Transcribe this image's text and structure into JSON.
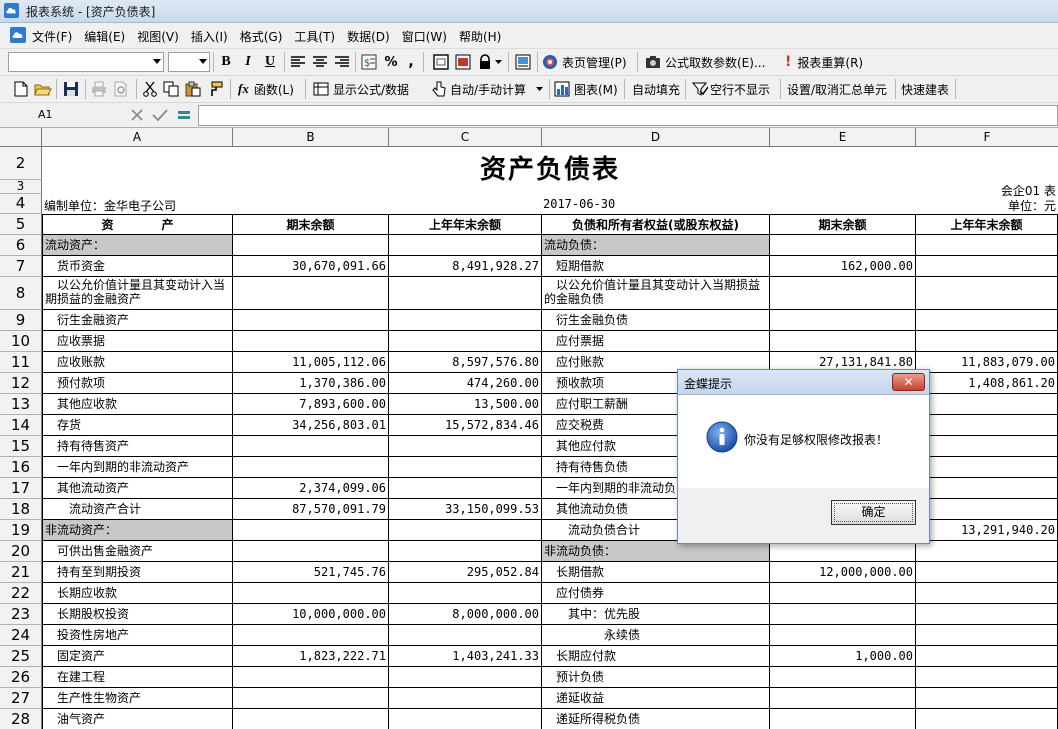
{
  "window": {
    "title": "报表系统 - [资产负债表]"
  },
  "menu": [
    "文件(F)",
    "编辑(E)",
    "视图(V)",
    "插入(I)",
    "格式(G)",
    "工具(T)",
    "数据(D)",
    "窗口(W)",
    "帮助(H)"
  ],
  "toolbar1": {
    "bold": "B",
    "italic": "I",
    "underline": "U",
    "percent": "%",
    "comma": ",",
    "page_manage": "表页管理(P)",
    "formula_params": "公式取数参数(E)...",
    "recalc": "报表重算(R)"
  },
  "toolbar2": {
    "function": "函数(L)",
    "show_formula": "显示公式/数据",
    "auto_manual": "自动/手动计算",
    "chart": "图表(M)",
    "auto_fill": "自动填充",
    "hide_blank": "空行不显示",
    "toggle_summary": "设置/取消汇总单元",
    "quick_build": "快速建表"
  },
  "formula_bar": {
    "cell_ref": "A1",
    "value": ""
  },
  "sheet": {
    "columns": [
      "A",
      "B",
      "C",
      "D",
      "E",
      "F"
    ],
    "row_numbers": [
      "2",
      "3",
      "4",
      "5",
      "6",
      "7",
      "8",
      "9",
      "10",
      "11",
      "12",
      "13",
      "14",
      "15",
      "16",
      "17",
      "18",
      "19",
      "20",
      "21",
      "22",
      "23",
      "24",
      "25",
      "26",
      "27",
      "28"
    ],
    "title": "资产负债表",
    "form_no": "会企01 表",
    "unit_label": "编制单位：金华电子公司",
    "date": "2017-06-30",
    "currency_unit": "单位：元",
    "headers": [
      "资　　　　产",
      "期末余额",
      "上年年末余额",
      "负债和所有者权益(或股东权益)",
      "期末余额",
      "上年年末余额"
    ],
    "rows": [
      {
        "a": "流动资产：",
        "b": "",
        "c": "",
        "d": "流动负债：",
        "e": "",
        "f": "",
        "ga": true,
        "gd": true
      },
      {
        "a": "　货币资金",
        "b": "30,670,091.66",
        "c": "8,491,928.27",
        "d": "　短期借款",
        "e": "162,000.00",
        "f": ""
      },
      {
        "a": "　以公允价值计量且其变动计入当期损益的金融资产",
        "b": "",
        "c": "",
        "d": "　以公允价值计量且其变动计入当期损益的金融负债",
        "e": "",
        "f": "",
        "two": true
      },
      {
        "a": "　衍生金融资产",
        "b": "",
        "c": "",
        "d": "　衍生金融负债",
        "e": "",
        "f": ""
      },
      {
        "a": "　应收票据",
        "b": "",
        "c": "",
        "d": "　应付票据",
        "e": "",
        "f": ""
      },
      {
        "a": "　应收账款",
        "b": "11,005,112.06",
        "c": "8,597,576.80",
        "d": "　应付账款",
        "e": "27,131,841.80",
        "f": "11,883,079.00"
      },
      {
        "a": "　预付款项",
        "b": "1,370,386.00",
        "c": "474,260.00",
        "d": "　预收款项",
        "e": "",
        "f": "1,408,861.20"
      },
      {
        "a": "　其他应收款",
        "b": "7,893,600.00",
        "c": "13,500.00",
        "d": "　应付职工薪酬",
        "e": "",
        "f": ""
      },
      {
        "a": "　存货",
        "b": "34,256,803.01",
        "c": "15,572,834.46",
        "d": "　应交税费",
        "e": "",
        "f": ""
      },
      {
        "a": "　持有待售资产",
        "b": "",
        "c": "",
        "d": "　其他应付款",
        "e": "",
        "f": ""
      },
      {
        "a": "　一年内到期的非流动资产",
        "b": "",
        "c": "",
        "d": "　持有待售负债",
        "e": "",
        "f": ""
      },
      {
        "a": "　其他流动资产",
        "b": "2,374,099.06",
        "c": "",
        "d": "　一年内到期的非流动负",
        "e": "",
        "f": ""
      },
      {
        "a": "　　流动资产合计",
        "b": "87,570,091.79",
        "c": "33,150,099.53",
        "d": "　其他流动负债",
        "e": "",
        "f": ""
      },
      {
        "a": "非流动资产：",
        "b": "",
        "c": "",
        "d": "　　流动负债合计",
        "e": "",
        "f": "13,291,940.20",
        "ga": true
      },
      {
        "a": "　可供出售金融资产",
        "b": "",
        "c": "",
        "d": "非流动负债：",
        "e": "",
        "f": "",
        "gd": true
      },
      {
        "a": "　持有至到期投资",
        "b": "521,745.76",
        "c": "295,052.84",
        "d": "　长期借款",
        "e": "12,000,000.00",
        "f": ""
      },
      {
        "a": "　长期应收款",
        "b": "",
        "c": "",
        "d": "　应付债券",
        "e": "",
        "f": ""
      },
      {
        "a": "　长期股权投资",
        "b": "10,000,000.00",
        "c": "8,000,000.00",
        "d": "　　其中：优先股",
        "e": "",
        "f": ""
      },
      {
        "a": "　投资性房地产",
        "b": "",
        "c": "",
        "d": "　　　　　永续债",
        "e": "",
        "f": ""
      },
      {
        "a": "　固定资产",
        "b": "1,823,222.71",
        "c": "1,403,241.33",
        "d": "　长期应付款",
        "e": "1,000.00",
        "f": ""
      },
      {
        "a": "　在建工程",
        "b": "",
        "c": "",
        "d": "　预计负债",
        "e": "",
        "f": ""
      },
      {
        "a": "　生产性生物资产",
        "b": "",
        "c": "",
        "d": "　递延收益",
        "e": "",
        "f": ""
      },
      {
        "a": "　油气资产",
        "b": "",
        "c": "",
        "d": "　递延所得税负债",
        "e": "",
        "f": ""
      }
    ]
  },
  "dialog": {
    "title": "金蝶提示",
    "message": "你没有足够权限修改报表！",
    "ok": "确定",
    "close": "✕"
  }
}
